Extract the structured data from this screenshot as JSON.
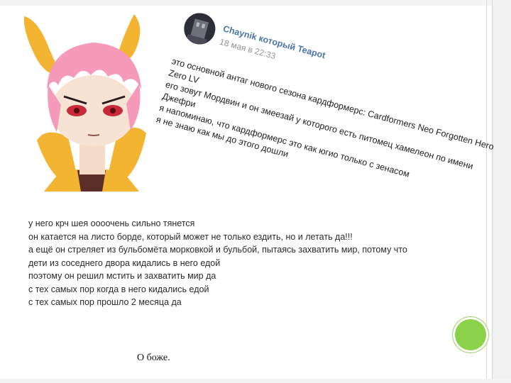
{
  "post": {
    "author": "Chaynik который Teapot",
    "date": "18 мая в 22:33",
    "lines": [
      "это основной антаг нового сезона кардформерс: Cardformers Neo Forgotten Hero",
      "Zero LV",
      "его зовут Мордвин и он змеезай у которого есть питомец хамелеон по имени",
      "Джефри",
      "я напоминаю, что кардформерс это как югио только с зенасом",
      "я не знаю как мы до этого дошли"
    ],
    "menu_glyph": "•••"
  },
  "main_text": {
    "lines": [
      "у него крч шея оооочень сильно тянется",
      "он катается на листо борде, который может не только ездить, но и летать да!!!",
      "а ещё он стреляет из бульбомёта морковкой и бульбой, пытаясь захватить мир, потому что",
      "дети из соседнего двора кидались в него едой",
      "поэтому он решил мстить и захватить мир да",
      "с тех самых пор когда в него кидались едой",
      "с тех самых пор прошло 2 месяца да"
    ]
  },
  "caption": "О боже.",
  "colors": {
    "author_link": "#4a76a8",
    "accent_circle": "#8ad24a",
    "hair": "#f59ab8",
    "ears": "#f2b431"
  }
}
